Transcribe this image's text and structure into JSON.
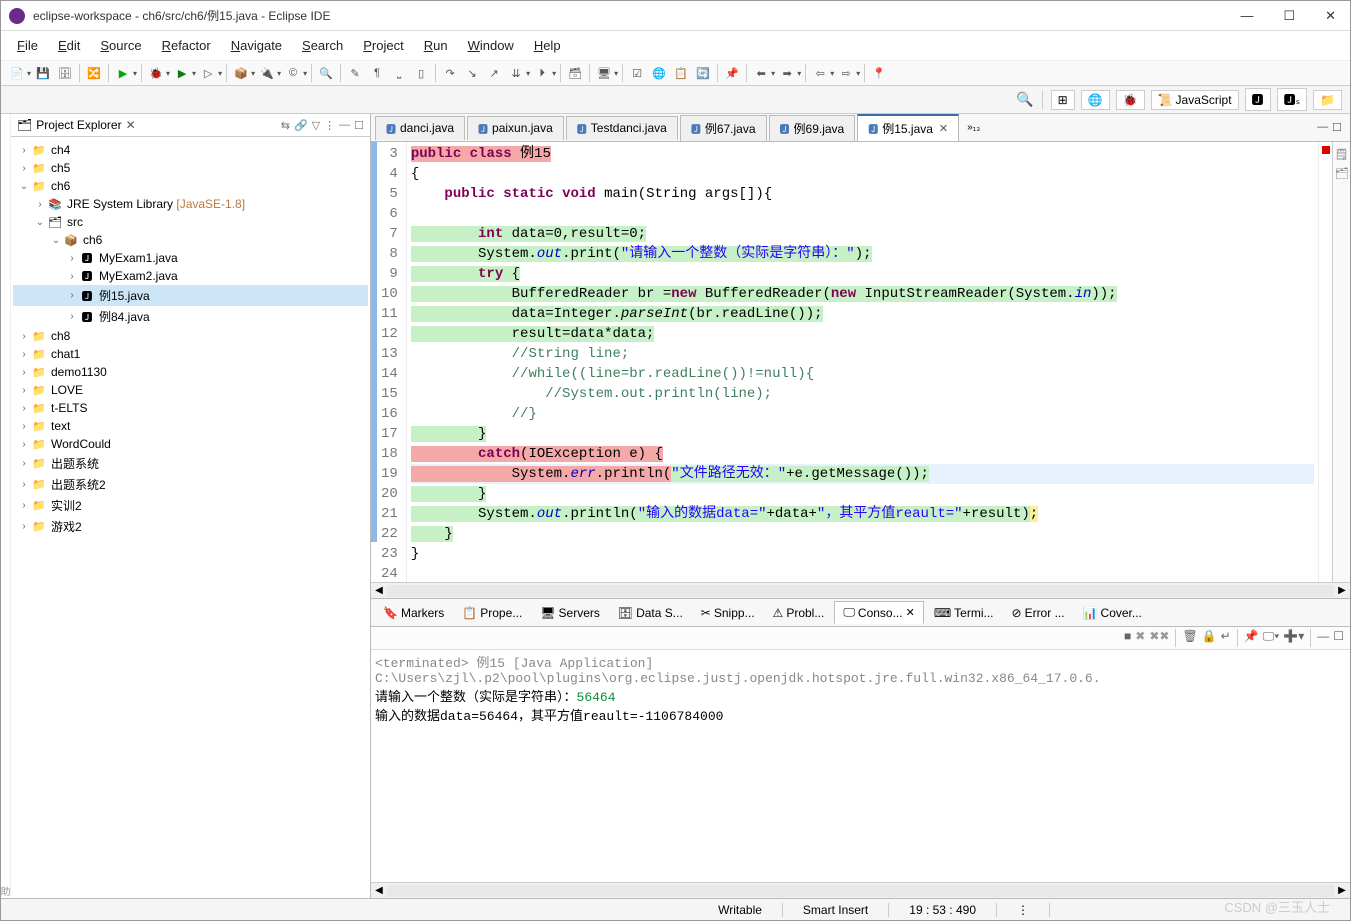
{
  "window": {
    "title": "eclipse-workspace - ch6/src/ch6/例15.java - Eclipse IDE"
  },
  "menus": [
    "File",
    "Edit",
    "Source",
    "Refactor",
    "Navigate",
    "Search",
    "Project",
    "Run",
    "Window",
    "Help"
  ],
  "perspective": {
    "active": "JavaScript"
  },
  "projectExplorer": {
    "title": "Project Explorer",
    "items": [
      {
        "indent": 0,
        "arrow": ">",
        "icon": "📁",
        "label": "ch4",
        "cls": "proj"
      },
      {
        "indent": 0,
        "arrow": ">",
        "icon": "📁",
        "label": "ch5",
        "cls": "proj"
      },
      {
        "indent": 0,
        "arrow": "v",
        "icon": "📁",
        "label": "ch6",
        "cls": "proj"
      },
      {
        "indent": 1,
        "arrow": ">",
        "icon": "📚",
        "label": "JRE System Library ",
        "hint": "[JavaSE-1.8]"
      },
      {
        "indent": 1,
        "arrow": "v",
        "icon": "🗂",
        "label": "src"
      },
      {
        "indent": 2,
        "arrow": "v",
        "icon": "📦",
        "label": "ch6"
      },
      {
        "indent": 3,
        "arrow": ">",
        "icon": "🅹",
        "label": "MyExam1.java"
      },
      {
        "indent": 3,
        "arrow": ">",
        "icon": "🅹",
        "label": "MyExam2.java"
      },
      {
        "indent": 3,
        "arrow": ">",
        "icon": "🅹",
        "label": "例15.java",
        "selected": true
      },
      {
        "indent": 3,
        "arrow": ">",
        "icon": "🅹",
        "label": "例84.java"
      },
      {
        "indent": 0,
        "arrow": ">",
        "icon": "📁",
        "label": "ch8",
        "cls": "proj"
      },
      {
        "indent": 0,
        "arrow": ">",
        "icon": "📁",
        "label": "chat1",
        "cls": "proj"
      },
      {
        "indent": 0,
        "arrow": ">",
        "icon": "📁",
        "label": "demo1130",
        "cls": "proj"
      },
      {
        "indent": 0,
        "arrow": ">",
        "icon": "📁",
        "label": "LOVE",
        "cls": "proj"
      },
      {
        "indent": 0,
        "arrow": ">",
        "icon": "📁",
        "label": "t-ELTS",
        "cls": "proj"
      },
      {
        "indent": 0,
        "arrow": ">",
        "icon": "📁",
        "label": "text",
        "cls": "proj"
      },
      {
        "indent": 0,
        "arrow": ">",
        "icon": "📁",
        "label": "WordCould",
        "cls": "proj"
      },
      {
        "indent": 0,
        "arrow": ">",
        "icon": "📁",
        "label": "出题系统",
        "cls": "proj"
      },
      {
        "indent": 0,
        "arrow": ">",
        "icon": "📁",
        "label": "出题系统2",
        "cls": "proj"
      },
      {
        "indent": 0,
        "arrow": ">",
        "icon": "📁",
        "label": "实训2",
        "cls": "proj"
      },
      {
        "indent": 0,
        "arrow": ">",
        "icon": "📁",
        "label": "游戏2",
        "cls": "proj"
      }
    ]
  },
  "editorTabs": [
    {
      "label": "danci.java",
      "active": false
    },
    {
      "label": "paixun.java",
      "active": false
    },
    {
      "label": "Testdanci.java",
      "active": false
    },
    {
      "label": "例67.java",
      "active": false
    },
    {
      "label": "例69.java",
      "active": false
    },
    {
      "label": "例15.java",
      "active": true
    }
  ],
  "code": {
    "startLine": 3,
    "lines": [
      {
        "n": 3,
        "html": "<span class='hl-red'><span class='kw'>public</span> <span class='kw'>class</span> 例15</span>",
        "b": true
      },
      {
        "n": 4,
        "html": "{",
        "b": true
      },
      {
        "n": 5,
        "html": "    <span class='kw'>public</span> <span class='kw'>static</span> <span class='kw'>void</span> main(String args[]){",
        "b": true,
        "fold": "-"
      },
      {
        "n": 6,
        "html": "",
        "b": true
      },
      {
        "n": 7,
        "html": "<span class='hl-green'>        <span class='kw'>int</span> data=0,result=0;</span>",
        "b": true
      },
      {
        "n": 8,
        "html": "<span class='hl-green'>        System.<span class='field'>out</span>.print(<span class='str'>\"请输入一个整数（实际是字符串）：\"</span>);</span>",
        "b": true
      },
      {
        "n": 9,
        "html": "<span class='hl-green'>        <span class='kw'>try</span> {</span>",
        "b": true
      },
      {
        "n": 10,
        "html": "<span class='hl-green'>            BufferedReader br =<span class='kw'>new</span> BufferedReader(<span class='kw'>new</span> InputStreamReader(System.<span class='field'>in</span>));</span>",
        "b": true
      },
      {
        "n": 11,
        "html": "<span class='hl-green'>            data=Integer.<span style='font-style:italic'>parseInt</span>(br.readLine());</span>",
        "b": true
      },
      {
        "n": 12,
        "html": "<span class='hl-green'>            result=data*data;</span>",
        "b": true
      },
      {
        "n": 13,
        "html": "            <span class='com'>//String line;</span>",
        "b": true
      },
      {
        "n": 14,
        "html": "            <span class='com'>//while((line=br.readLine())!=null){</span>",
        "b": true
      },
      {
        "n": 15,
        "html": "                <span class='com'>//System.out.println(line);</span>",
        "b": true
      },
      {
        "n": 16,
        "html": "            <span class='com'>//}</span>",
        "b": true
      },
      {
        "n": 17,
        "html": "<span class='hl-green'>        }</span>",
        "b": true
      },
      {
        "n": 18,
        "html": "<span class='hl-red'>        <span class='kw'>catch</span>(IOException e) {</span>",
        "b": true
      },
      {
        "n": 19,
        "html": "<span class='hl-red'>            System.<span class='field'>err</span>.println(</span><span class='hl-green'><span class='str'>\"文件路径无效：\"</span>+e.getMessage());</span>",
        "b": true,
        "current": true
      },
      {
        "n": 20,
        "html": "<span class='hl-green'>        }</span>",
        "b": true
      },
      {
        "n": 21,
        "html": "<span class='hl-green'>        System.<span class='field'>out</span>.println(<span class='str'>\"输入的数据data=\"</span>+data+<span class='str'>\"，其平方值reault=\"</span>+result)</span><span class='hl-yellow'>;</span>",
        "b": true
      },
      {
        "n": 22,
        "html": "<span class='hl-green'>    }</span>",
        "b": true
      },
      {
        "n": 23,
        "html": "}",
        "b": false
      },
      {
        "n": 24,
        "html": "",
        "b": false
      }
    ]
  },
  "bottomTabs": [
    {
      "label": "Markers",
      "icon": "🔖"
    },
    {
      "label": "Prope...",
      "icon": "📋"
    },
    {
      "label": "Servers",
      "icon": "🖥"
    },
    {
      "label": "Data S...",
      "icon": "🗄"
    },
    {
      "label": "Snipp...",
      "icon": "✂"
    },
    {
      "label": "Probl...",
      "icon": "⚠"
    },
    {
      "label": "Conso...",
      "icon": "🖵",
      "active": true
    },
    {
      "label": "Termi...",
      "icon": "⌨"
    },
    {
      "label": "Error ...",
      "icon": "⊘"
    },
    {
      "label": "Cover...",
      "icon": "📊"
    }
  ],
  "console": {
    "header": "<terminated> 例15 [Java Application] C:\\Users\\zjl\\.p2\\pool\\plugins\\org.eclipse.justj.openjdk.hotspot.jre.full.win32.x86_64_17.0.6.",
    "line1_prompt": "请输入一个整数（实际是字符串）：",
    "line1_input": "56464",
    "line2": "输入的数据data=56464，其平方值reault=-1106784000"
  },
  "statusbar": {
    "mode": "Writable",
    "insert": "Smart Insert",
    "position": "19 : 53 : 490"
  },
  "watermark": "CSDN @三玉人士"
}
